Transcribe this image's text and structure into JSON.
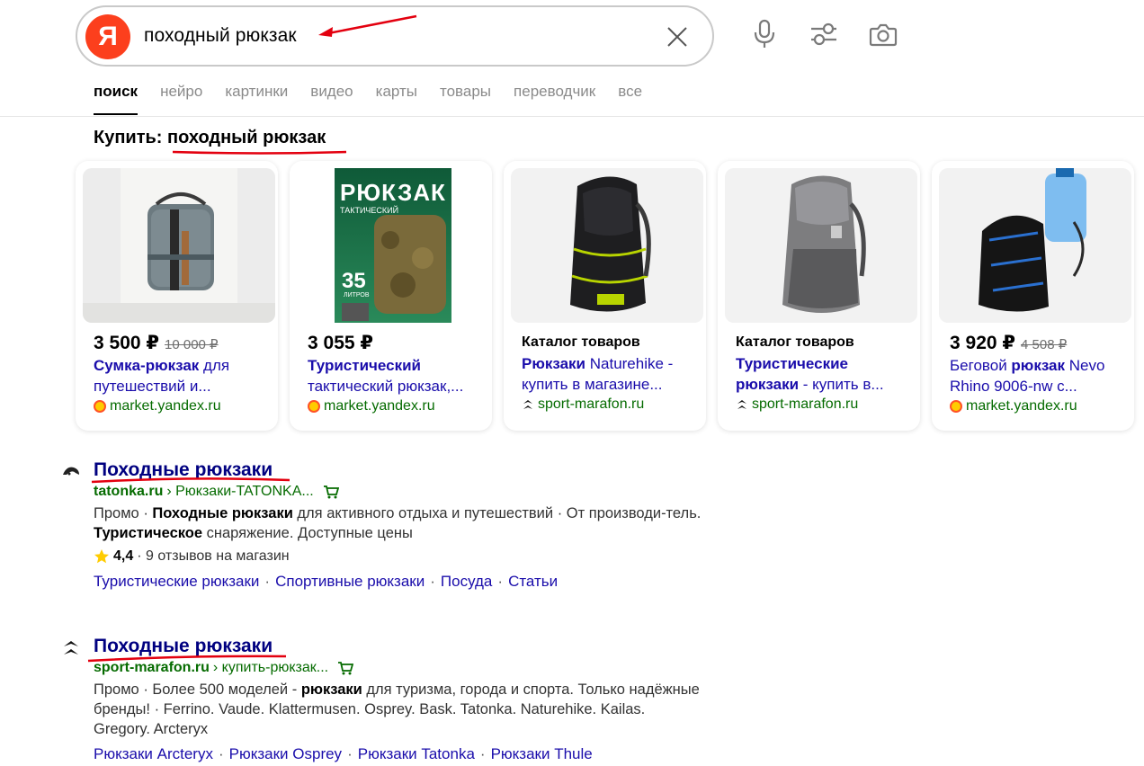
{
  "search": {
    "logo": "Я",
    "query": "походный рюкзак"
  },
  "tabs": [
    {
      "label": "поиск",
      "active": true
    },
    {
      "label": "нейро"
    },
    {
      "label": "картинки"
    },
    {
      "label": "видео"
    },
    {
      "label": "карты"
    },
    {
      "label": "товары"
    },
    {
      "label": "переводчик"
    },
    {
      "label": "все"
    }
  ],
  "buy": {
    "prefix": "Купить:",
    "query": "походный рюкзак"
  },
  "cards": [
    {
      "price": "3 500 ₽",
      "old_price": "10 000 ₽",
      "title_bold": "Сумка-рюкзак",
      "title_rest": " для путешествий и...",
      "source": "market.yandex.ru",
      "source_icon": "yandex-market-icon"
    },
    {
      "price": "3 055 ₽",
      "title_bold": "Туристический",
      "title_rest": " тактический рюкзак,...",
      "cover_title": "РЮКЗАК",
      "cover_sub": "ТАКТИЧЕСКИЙ",
      "cover_num": "35",
      "cover_unit": "ЛИТРОВ",
      "source": "market.yandex.ru",
      "source_icon": "yandex-market-icon"
    },
    {
      "catalog": "Каталог товаров",
      "title_bold": "Рюкзаки",
      "title_rest": " Naturehike - купить в магазине...",
      "source": "sport-marafon.ru",
      "source_icon": "sport-marafon-icon"
    },
    {
      "catalog": "Каталог товаров",
      "title_bold": "Туристические рюкзаки",
      "title_rest": " - купить в...",
      "source": "sport-marafon.ru",
      "source_icon": "sport-marafon-icon"
    },
    {
      "price": "3 920 ₽",
      "old_price": "4 508 ₽",
      "title_pre": "Беговой ",
      "title_bold": "рюкзак",
      "title_rest": " Nevo Rhino 9006-nw с...",
      "source": "market.yandex.ru",
      "source_icon": "yandex-market-icon"
    }
  ],
  "results": [
    {
      "title": "Походные рюкзаки",
      "domain": "tatonka.ru",
      "path": "› Рюкзаки-TATONKA...",
      "snippet": {
        "s1": "Промо · ",
        "b1": "Походные рюкзаки",
        "s2": " для активного отдыха и путешествий · От производи-тель. ",
        "b2": "Туристическое",
        "s3": " снаряжение. Доступные цены"
      },
      "rating": {
        "value": "4,4",
        "text": "· 9 отзывов на магазин"
      },
      "sitelinks": [
        "Туристические рюкзаки",
        "Спортивные рюкзаки",
        "Посуда",
        "Статьи"
      ]
    },
    {
      "title": "Походные рюкзаки",
      "domain": "sport-marafon.ru",
      "path": "› купить-рюкзак...",
      "snippet": {
        "s1": "Промо · Более 500 моделей - ",
        "b1": "рюкзаки",
        "s2": " для туризма, города и спорта. Только надёжные бренды! · Ferrino. Vaude. Klattermusen. Osprey. Bask. Tatonka. Naturehike. Kailas. Gregory. Arcteryx"
      },
      "sitelinks": [
        "Рюкзаки Arcteryx",
        "Рюкзаки Osprey",
        "Рюкзаки Tatonka",
        "Рюкзаки Thule"
      ]
    }
  ],
  "colors": {
    "brand": "#fc3f1d",
    "link": "#1a0dab",
    "title": "#000080",
    "url": "#056b00",
    "annotation": "#e3000f"
  }
}
